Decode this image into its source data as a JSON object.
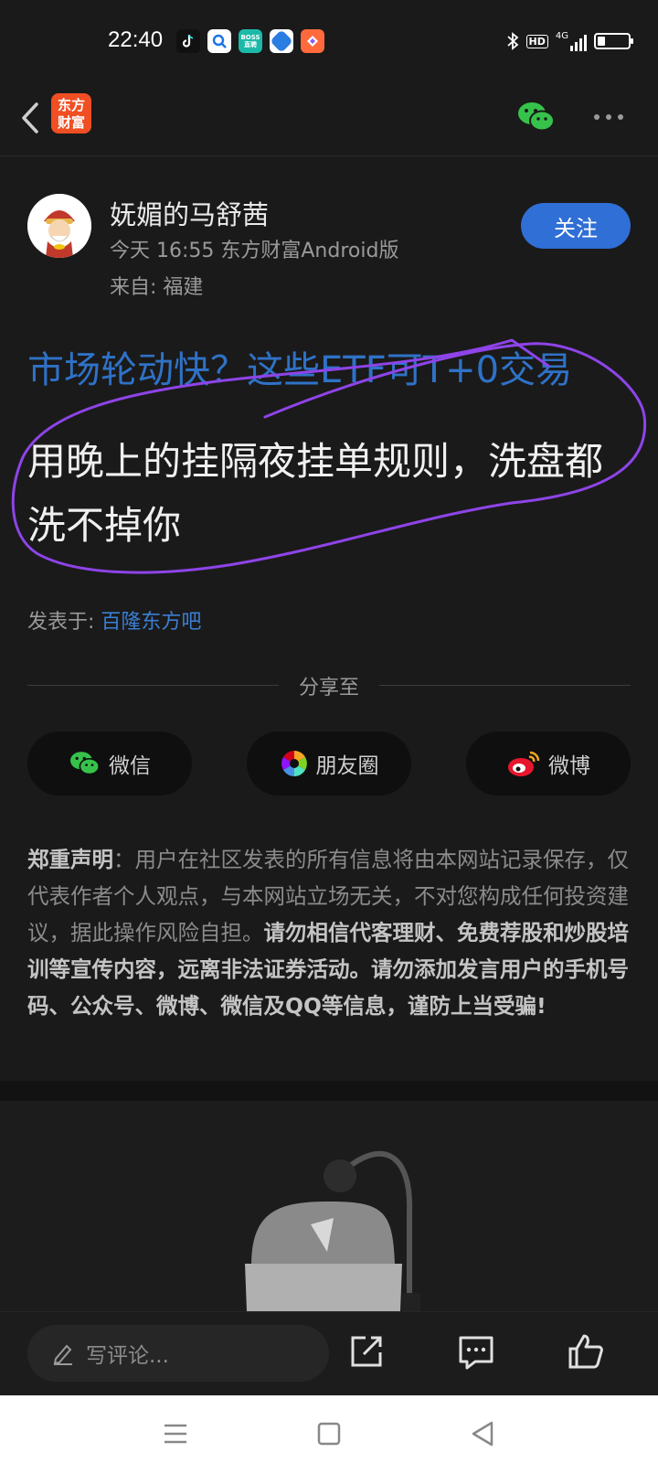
{
  "status_bar": {
    "time": "22:40",
    "apps": [
      "tiktok-icon",
      "search-app-icon",
      "boss-app-icon",
      "browser-app-icon",
      "shortcut-app-icon"
    ],
    "boss_label": "BOSS\n直聘",
    "indicators": [
      "bluetooth-icon",
      "hd-icon",
      "4g-signal-icon",
      "battery-icon"
    ],
    "hd": "HD",
    "network": "4G"
  },
  "header": {
    "logo_text": "东方\n财富",
    "icons": [
      "back-icon",
      "wechat-icon",
      "more-icon"
    ]
  },
  "author": {
    "name": "妩媚的马舒茜",
    "meta": "今天 16:55 东方财富Android版",
    "from": "来自: 福建",
    "follow_label": "关注"
  },
  "post": {
    "topic": "市场轮动快？这些ETF可T+0交易",
    "title": "用晚上的挂隔夜挂单规则，洗盘都洗不掉你",
    "posted_prefix": "发表于: ",
    "posted_bar": "百隆东方吧"
  },
  "share": {
    "label": "分享至",
    "buttons": [
      {
        "label": "微信",
        "icon": "wechat-icon"
      },
      {
        "label": "朋友圈",
        "icon": "moments-icon"
      },
      {
        "label": "微博",
        "icon": "weibo-icon"
      }
    ]
  },
  "disclaimer": {
    "heading": "郑重声明",
    "colon": "：",
    "normal": "用户在社区发表的所有信息将由本网站记录保存，仅代表作者个人观点，与本网站立场无关，不对您构成任何投资建议，据此操作风险自担。",
    "bold": "请勿相信代客理财、免费荐股和炒股培训等宣传内容，远离非法证券活动。请勿添加发言用户的手机号码、公众号、微博、微信及QQ等信息，谨防上当受骗!"
  },
  "bottom_bar": {
    "comment_placeholder": "写评论...",
    "icons": [
      "pencil-icon",
      "share-out-icon",
      "comment-icon",
      "like-icon"
    ]
  },
  "nav_bar": {
    "icons": [
      "menu-icon",
      "home-icon",
      "back-nav-icon"
    ]
  },
  "colors": {
    "background": "#1a1a1a",
    "accent_blue": "#2f6fd6",
    "link_blue": "#3a7fd5",
    "scribble_purple": "#8e44e8",
    "logo_orange": "#f04e23"
  }
}
